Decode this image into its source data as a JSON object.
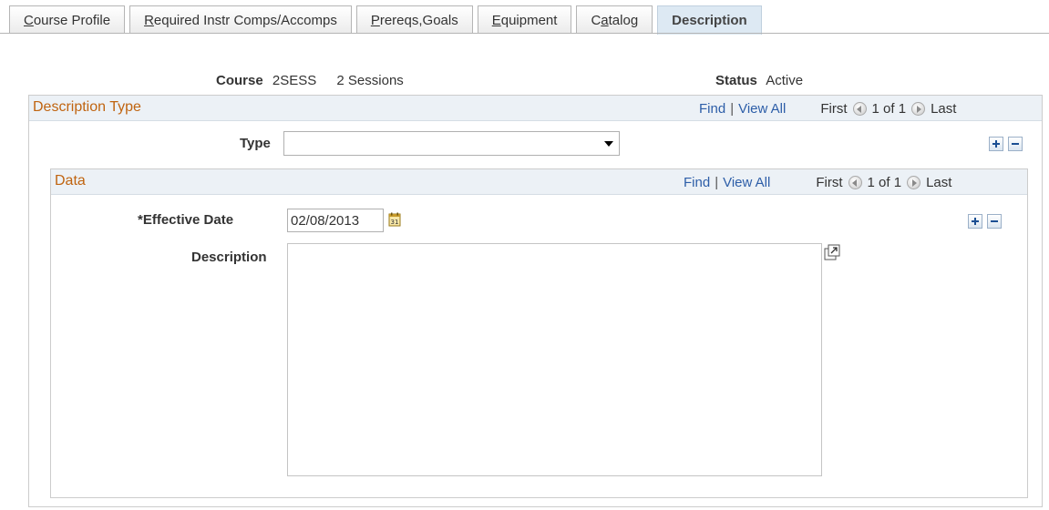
{
  "tabs": [
    {
      "label": "Course Profile",
      "underline": "C",
      "rest": "ourse Profile",
      "active": false
    },
    {
      "label": "Required Instr Comps/Accomps",
      "underline": "R",
      "rest": "equired Instr Comps/Accomps",
      "active": false
    },
    {
      "label": "Prereqs,Goals",
      "underline": "P",
      "rest": "rereqs,Goals",
      "active": false
    },
    {
      "label": "Equipment",
      "underline": "E",
      "rest": "quipment",
      "active": false
    },
    {
      "label": "Catalog",
      "pre": "C",
      "underline": "a",
      "rest": "talog",
      "active": false
    },
    {
      "label": "Description",
      "active": true
    }
  ],
  "header": {
    "course_label": "Course",
    "course_code": "2SESS",
    "course_name": "2 Sessions",
    "status_label": "Status",
    "status_value": "Active"
  },
  "description_type_area": {
    "title": "Description Type",
    "find": "Find",
    "separator": "|",
    "view_all": "View All",
    "first": "First",
    "count": "1 of 1",
    "last": "Last",
    "type_label": "Type",
    "type_value": ""
  },
  "data_area": {
    "title": "Data",
    "find": "Find",
    "separator": "|",
    "view_all": "View All",
    "first": "First",
    "count": "1 of 1",
    "last": "Last",
    "effective_date_label": "*Effective Date",
    "effective_date_value": "02/08/2013",
    "description_label": "Description",
    "description_value": ""
  },
  "colors": {
    "area_title": "#c06410",
    "link": "#2d5ea8",
    "header_band": "#ecf1f6",
    "active_tab": "#dde9f3"
  },
  "icons": {
    "prev": "arrow-left-icon",
    "next": "arrow-right-icon",
    "add": "plus-icon",
    "remove": "minus-icon",
    "calendar": "calendar-icon",
    "expand": "expand-textarea-icon"
  }
}
